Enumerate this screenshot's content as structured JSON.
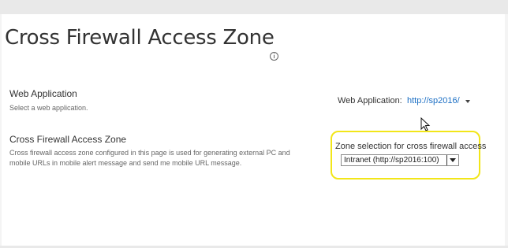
{
  "page": {
    "title": "Cross Firewall Access Zone"
  },
  "web_application_section": {
    "title": "Web Application",
    "description": "Select a web application.",
    "selector_label": "Web Application:",
    "selector_value": "http://sp2016/"
  },
  "zone_section": {
    "title": "Cross Firewall Access Zone",
    "description": "Cross firewall access zone configured in this page is used for generating external PC and mobile URLs in mobile alert message and send me mobile URL message.",
    "selector_label": "Zone selection for cross firewall access",
    "selected_zone": "Intranet (http://sp2016:100)"
  },
  "colors": {
    "link": "#1a6ec4",
    "highlight": "#f2e619",
    "background": "#ffffff"
  },
  "icons": {
    "title_help": "info-icon",
    "web_app_dropdown": "caret-down-icon",
    "zone_dropdown": "chevron-down-icon",
    "pointer": "mouse-cursor-icon"
  }
}
